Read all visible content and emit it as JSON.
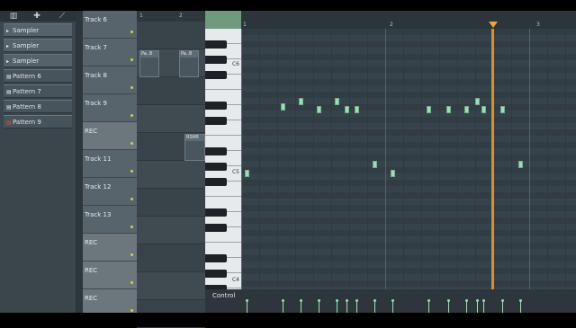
{
  "browser": {
    "toolbar_icons": [
      "piano-icon",
      "plus-icon",
      "brush-icon"
    ],
    "items": [
      {
        "label": "Sampler",
        "icon": "arrow-right-icon"
      },
      {
        "label": "Sampler",
        "icon": "arrow-right-icon"
      },
      {
        "label": "Sampler",
        "icon": "arrow-right-icon"
      },
      {
        "label": "Pattern 6",
        "icon": "pattern-icon"
      },
      {
        "label": "Pattern 7",
        "icon": "pattern-icon"
      },
      {
        "label": "Pattern 8",
        "icon": "pattern-icon"
      },
      {
        "label": "Pattern 9",
        "icon": "pattern-active-icon"
      }
    ]
  },
  "playlist": {
    "ruler_marks": [
      "1",
      "2"
    ],
    "tracks": [
      {
        "label": "Track 6",
        "rec": false
      },
      {
        "label": "Track 7",
        "rec": false
      },
      {
        "label": "Track 8",
        "rec": false
      },
      {
        "label": "Track 9",
        "rec": false
      },
      {
        "label": "REC",
        "rec": true
      },
      {
        "label": "Track 11",
        "rec": false
      },
      {
        "label": "Track 12",
        "rec": false
      },
      {
        "label": "Track 13",
        "rec": false
      },
      {
        "label": "REC",
        "rec": true
      },
      {
        "label": "REC",
        "rec": true
      },
      {
        "label": "REC",
        "rec": true
      }
    ],
    "clips": [
      {
        "label": "Pa..8"
      },
      {
        "label": "Pa..8"
      },
      {
        "label": "RSHR"
      }
    ]
  },
  "pianoroll": {
    "ruler_marks": [
      "1",
      "2",
      "3"
    ],
    "octave_labels": [
      "C6",
      "C5",
      "C4"
    ],
    "control_label": "Control",
    "playhead_color": "#e08d2a",
    "note_color": "#9fdcb8"
  }
}
